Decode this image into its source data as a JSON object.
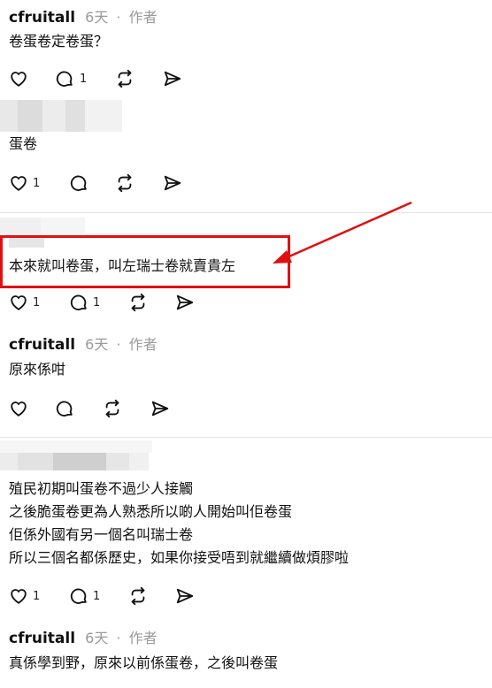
{
  "comments": [
    {
      "username": "cfruitall",
      "time": "6天",
      "author_tag": "作者",
      "text": "卷蛋卷定卷蛋？",
      "like_count": "",
      "reply_count": "1"
    },
    {
      "username": "",
      "time": "",
      "author_tag": "",
      "text": "蛋卷",
      "like_count": "1",
      "reply_count": ""
    },
    {
      "username": "",
      "time": "",
      "author_tag": "",
      "text": "本來就叫卷蛋，叫左瑞士卷就賣貴左",
      "like_count": "1",
      "reply_count": "1"
    },
    {
      "username": "cfruitall",
      "time": "6天",
      "author_tag": "作者",
      "text": "原來係咁",
      "like_count": "",
      "reply_count": ""
    },
    {
      "username": "",
      "time": "",
      "author_tag": "",
      "lines": [
        "殖民初期叫蛋卷不過少人接觸",
        "之後脆蛋卷更為人熟悉所以啲人開始叫佢卷蛋",
        "佢係外國有另一個名叫瑞士卷",
        "所以三個名都係歷史，如果你接受唔到就繼續做煩膠啦"
      ],
      "like_count": "1",
      "reply_count": "1"
    },
    {
      "username": "cfruitall",
      "time": "6天",
      "author_tag": "作者",
      "text": "真係學到野，原來以前係蛋卷，之後叫卷蛋"
    }
  ],
  "separator": "·",
  "colors": {
    "annotation": "#e01010",
    "meta": "#9a9a9a"
  },
  "icons": [
    "heart-icon",
    "comment-icon",
    "repost-icon",
    "share-icon"
  ]
}
